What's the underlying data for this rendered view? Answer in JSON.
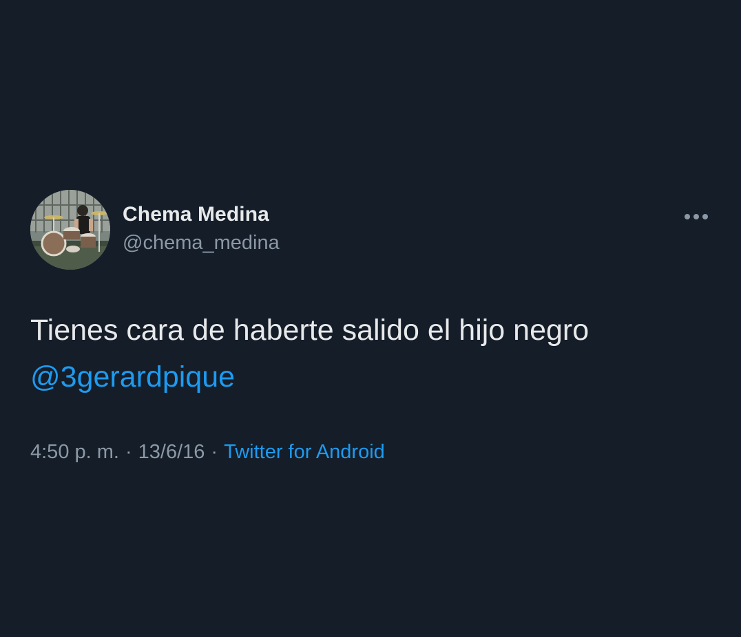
{
  "tweet": {
    "author": {
      "display_name": "Chema Medina",
      "handle": "@chema_medina"
    },
    "body": {
      "text": "Tienes cara de haberte salido el hijo negro",
      "mention": "@3gerardpique"
    },
    "meta": {
      "time": "4:50 p. m.",
      "separator": "·",
      "date": "13/6/16",
      "source": "Twitter for Android"
    },
    "more_icon": "more-horizontal-icon"
  },
  "colors": {
    "background": "#151d29",
    "primary_text": "#e7e9ea",
    "secondary_text": "#8b98a5",
    "accent": "#1d9bf0"
  }
}
